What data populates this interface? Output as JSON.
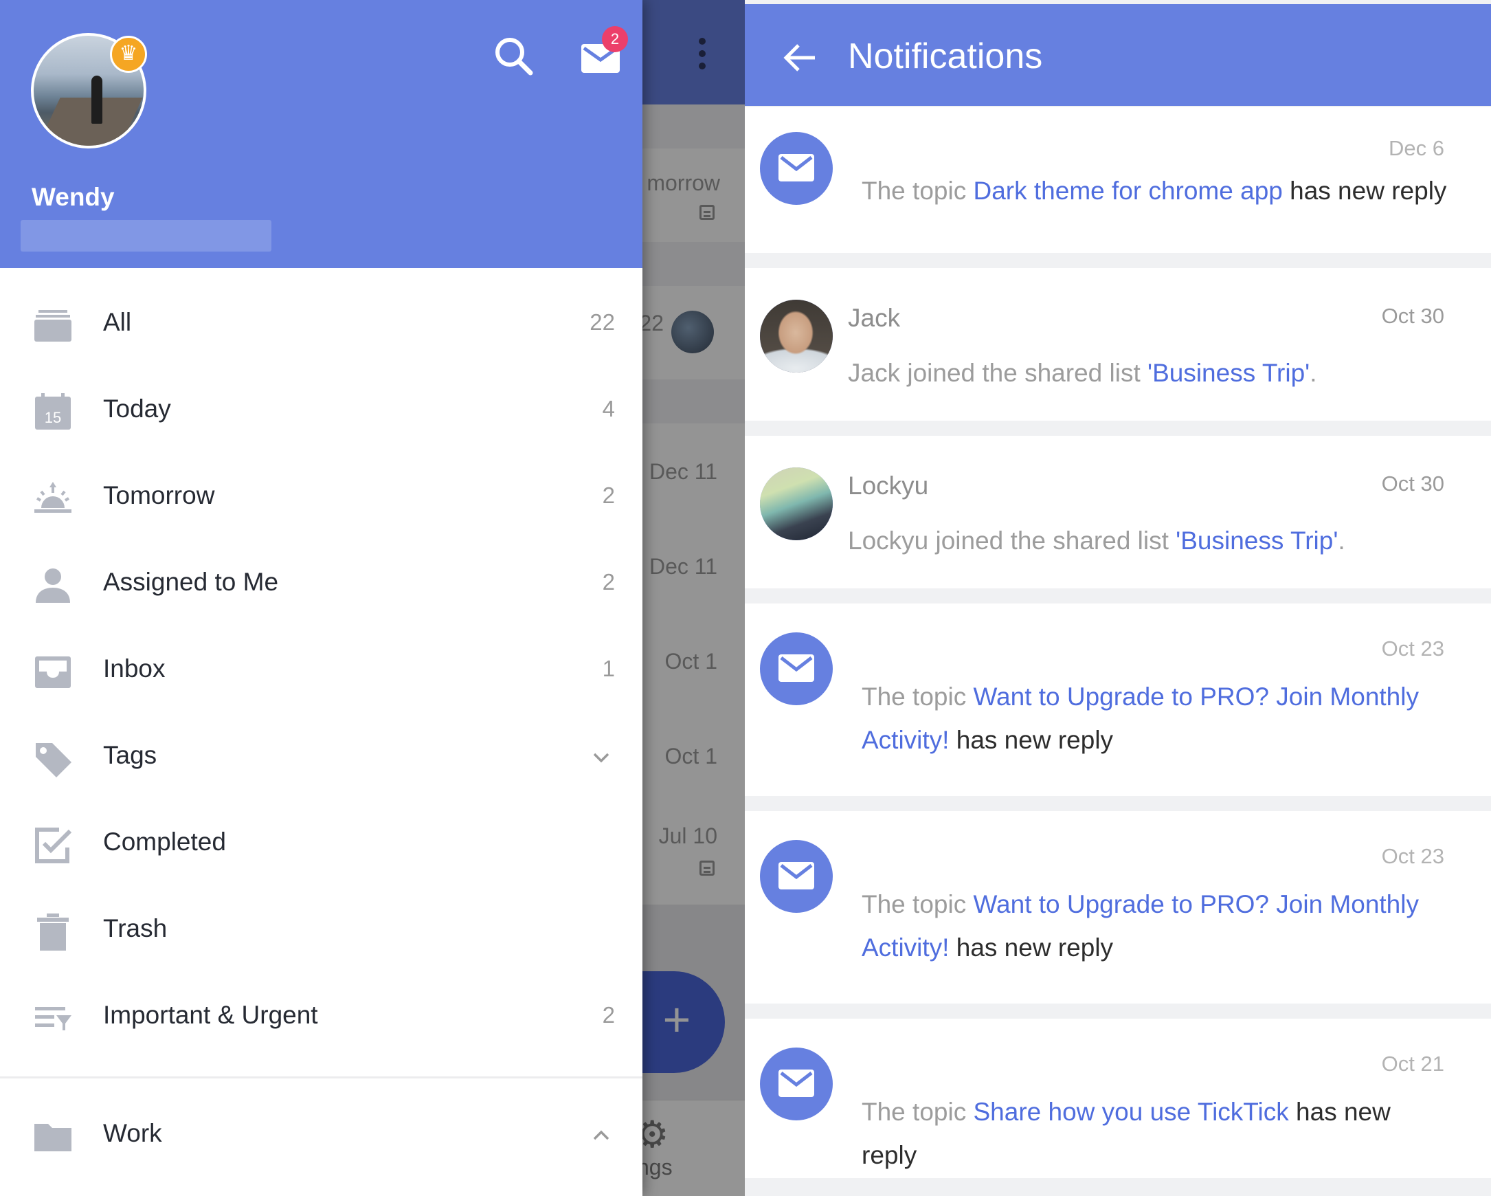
{
  "drawer": {
    "username": "Wendy",
    "mail_badge": "2",
    "nav": [
      {
        "label": "All",
        "count": "22",
        "icon": "stack-icon"
      },
      {
        "label": "Today",
        "count": "4",
        "icon": "calendar-icon",
        "icon_text": "15"
      },
      {
        "label": "Tomorrow",
        "count": "2",
        "icon": "sunrise-icon"
      },
      {
        "label": "Assigned to Me",
        "count": "2",
        "icon": "person-icon"
      },
      {
        "label": "Inbox",
        "count": "1",
        "icon": "inbox-icon"
      },
      {
        "label": "Tags",
        "count": "",
        "icon": "tag-icon"
      },
      {
        "label": "Completed",
        "count": "",
        "icon": "checkbox-icon"
      },
      {
        "label": "Trash",
        "count": "",
        "icon": "trash-icon"
      },
      {
        "label": "Important & Urgent",
        "count": "2",
        "icon": "filter-list-icon"
      },
      {
        "label": "Work",
        "count": "",
        "icon": "folder-icon"
      }
    ]
  },
  "background_list": {
    "texts": [
      "morrow",
      "22",
      "Dec 11",
      "Dec 11",
      "Oct 1",
      "Oct 1",
      "Jul 10"
    ],
    "settings_label": "tings"
  },
  "notifications": {
    "title": "Notifications",
    "items": [
      {
        "type": "topic",
        "date": "Dec 6",
        "prefix": "The topic ",
        "link": "Dark theme for chrome app",
        "suffix": " has new reply"
      },
      {
        "type": "user",
        "name": "Jack",
        "date": "Oct 30",
        "message": "Jack joined the shared list ",
        "link": "'Business Trip'",
        "end": "."
      },
      {
        "type": "user",
        "name": "Lockyu",
        "date": "Oct 30",
        "message": "Lockyu joined the shared list ",
        "link": "'Business Trip'",
        "end": "."
      },
      {
        "type": "topic",
        "date": "Oct 23",
        "prefix": "The topic ",
        "link": "Want to Upgrade to PRO? Join Monthly Activity!",
        "suffix": " has new reply"
      },
      {
        "type": "topic",
        "date": "Oct 23",
        "prefix": "The topic ",
        "link": "Want to Upgrade to PRO? Join Monthly Activity!",
        "suffix": " has new reply"
      },
      {
        "type": "topic",
        "date": "Oct 21",
        "prefix": "The topic ",
        "link": "Share how you use TickTick",
        "suffix": " has new reply"
      }
    ]
  },
  "colors": {
    "accent": "#6680e0",
    "link": "#4f6dde",
    "badge": "#ec3f6a",
    "crown": "#f5a623"
  }
}
